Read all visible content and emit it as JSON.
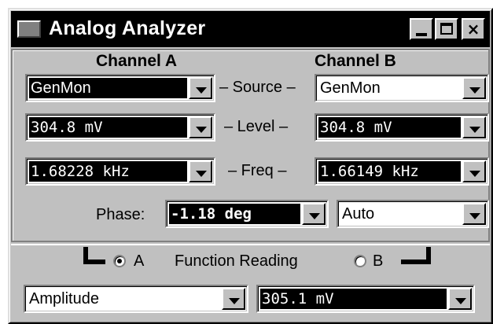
{
  "window": {
    "title": "Analog Analyzer",
    "buttons": {
      "minimize": "_",
      "maximize": "□",
      "close": "×"
    }
  },
  "channels": {
    "a_header": "Channel A",
    "b_header": "Channel B"
  },
  "rows": {
    "source_label": "– Source –",
    "level_label": "– Level –",
    "freq_label": "– Freq –"
  },
  "channel_a": {
    "source": "GenMon",
    "level": "304.8   mV",
    "freq": "1.68228 kHz"
  },
  "channel_b": {
    "source": "GenMon",
    "level": "304.8   mV",
    "freq": "1.66149 kHz"
  },
  "phase": {
    "label": "Phase:",
    "value": "-1.18   deg",
    "mode": "Auto"
  },
  "function": {
    "radio_a_label": "A",
    "label": "Function Reading",
    "radio_b_label": "B",
    "selected_channel": "A",
    "function_select": "Amplitude",
    "reading": "305.1   mV"
  }
}
